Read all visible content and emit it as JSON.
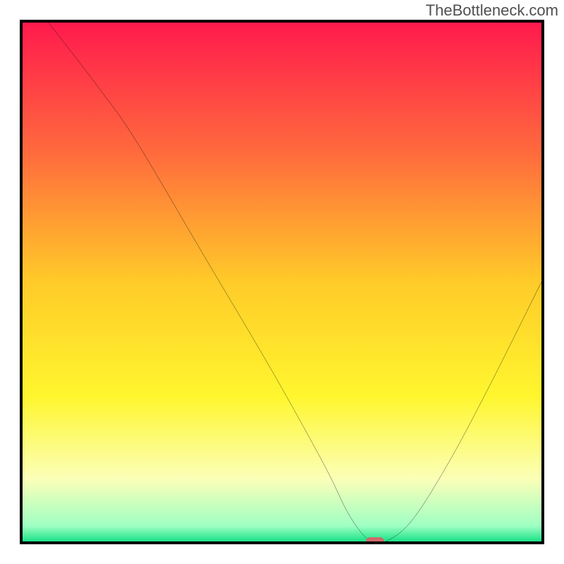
{
  "watermark": "TheBottleneck.com",
  "chart_data": {
    "type": "line",
    "title": "",
    "xlabel": "",
    "ylabel": "",
    "xlim": [
      0,
      100
    ],
    "ylim": [
      0,
      100
    ],
    "grid": false,
    "legend": false,
    "background_gradient": {
      "stops": [
        {
          "pos": 0.0,
          "color": "#ff1a4d"
        },
        {
          "pos": 0.25,
          "color": "#ff6a3d"
        },
        {
          "pos": 0.5,
          "color": "#ffcb29"
        },
        {
          "pos": 0.72,
          "color": "#fff62e"
        },
        {
          "pos": 0.88,
          "color": "#fbffb8"
        },
        {
          "pos": 0.97,
          "color": "#9fffc3"
        },
        {
          "pos": 1.0,
          "color": "#19e387"
        }
      ]
    },
    "series": [
      {
        "name": "bottleneck-curve",
        "x": [
          5,
          15,
          22,
          35,
          48,
          58,
          63,
          67,
          70,
          75,
          82,
          90,
          100
        ],
        "y": [
          100,
          87,
          77,
          55,
          33,
          15,
          5,
          0,
          0,
          4,
          15,
          30,
          50
        ]
      }
    ],
    "marker": {
      "name": "optimal-point",
      "x": 68,
      "y": 0,
      "color": "#cf6a6a"
    }
  }
}
